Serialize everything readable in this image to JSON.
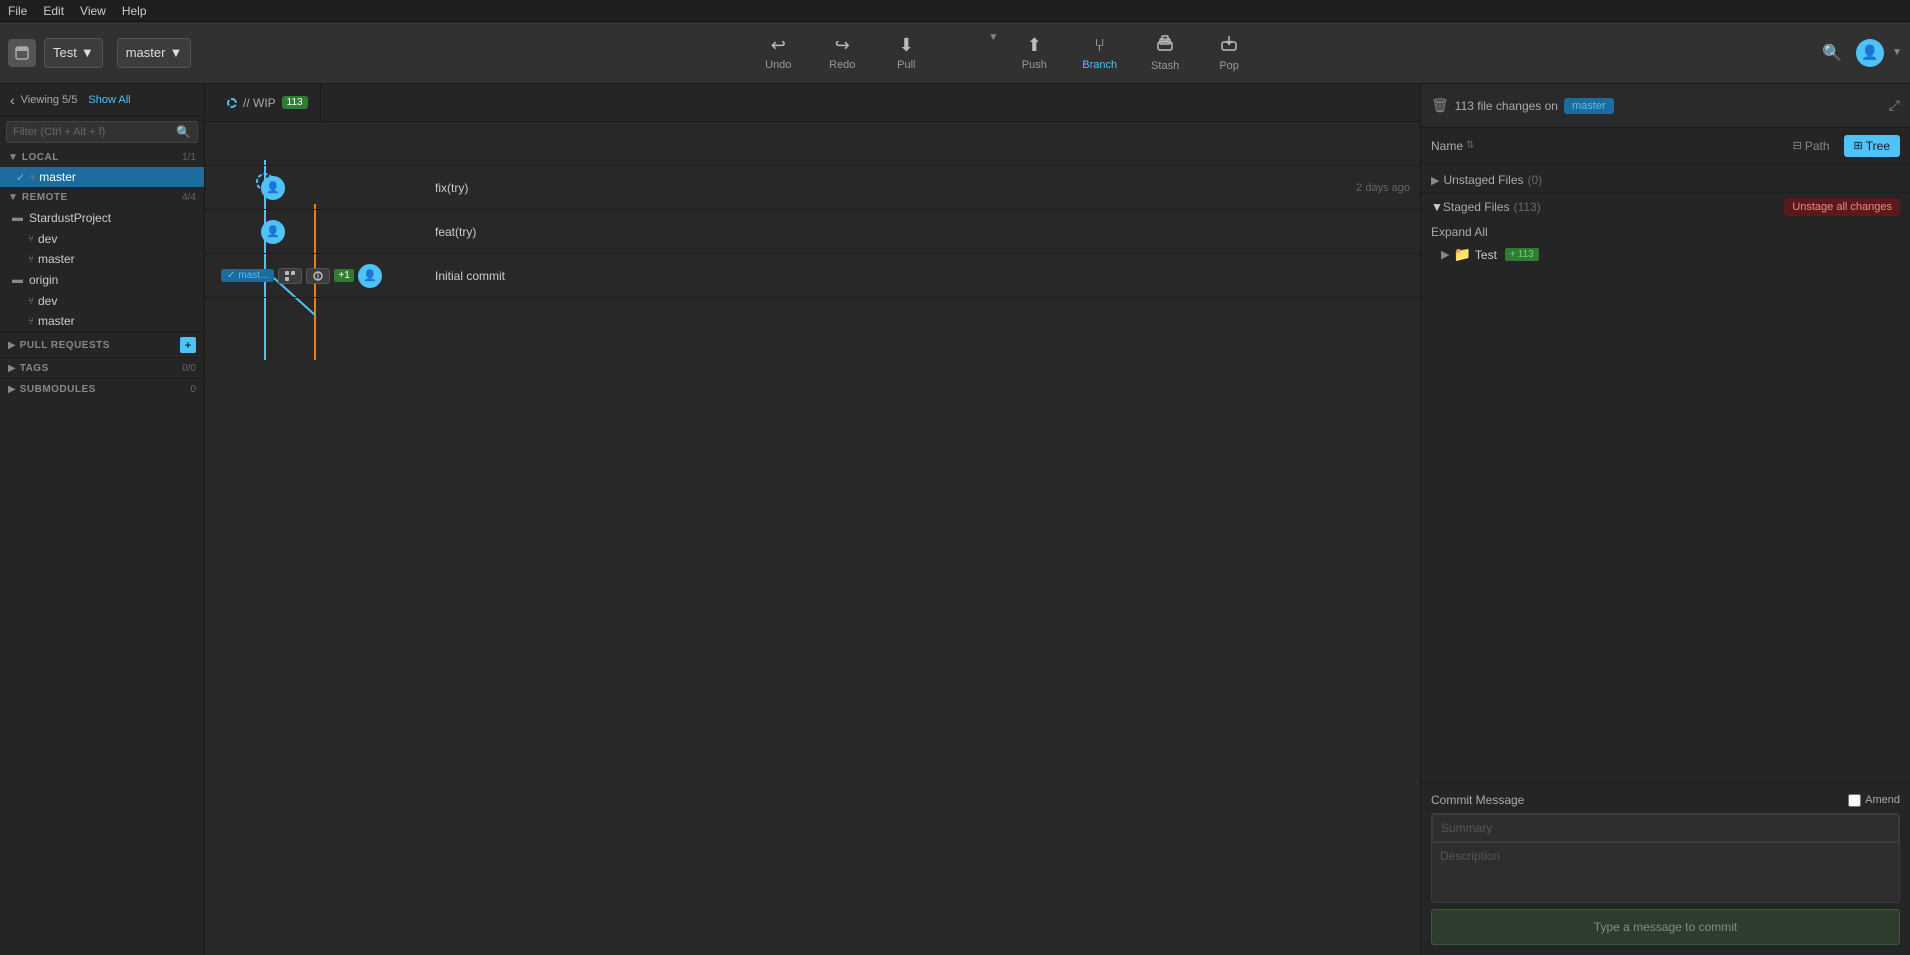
{
  "menubar": {
    "items": [
      "File",
      "Edit",
      "View",
      "Help"
    ]
  },
  "toolbar": {
    "repo_label": "Test",
    "branch_label": "master",
    "buttons": [
      {
        "id": "undo",
        "label": "Undo",
        "icon": "↩"
      },
      {
        "id": "redo",
        "label": "Redo",
        "icon": "↪"
      },
      {
        "id": "pull",
        "label": "Pull",
        "icon": "⬇"
      },
      {
        "id": "push",
        "label": "Push",
        "icon": "⬆"
      },
      {
        "id": "branch",
        "label": "Branch",
        "icon": "⑂"
      },
      {
        "id": "stash",
        "label": "Stash",
        "icon": "📦"
      },
      {
        "id": "pop",
        "label": "Pop",
        "icon": "📤"
      }
    ]
  },
  "sidebar": {
    "viewing_text": "Viewing 5/5",
    "show_all": "Show All",
    "filter_placeholder": "Filter (Ctrl + Alt + f)",
    "sections": {
      "local": {
        "title": "LOCAL",
        "count": "1/1",
        "branches": [
          "master"
        ]
      },
      "remote": {
        "title": "REMOTE",
        "count": "4/4",
        "remotes": [
          {
            "name": "StardustProject",
            "branches": [
              "dev",
              "master"
            ]
          },
          {
            "name": "origin",
            "branches": [
              "dev",
              "master"
            ]
          }
        ]
      },
      "pull_requests": {
        "title": "PULL REQUESTS"
      },
      "tags": {
        "title": "TAGS",
        "count": "0/0"
      },
      "submodules": {
        "title": "SUBMODULES",
        "count": "0"
      }
    }
  },
  "graph": {
    "wip_label": "// WIP",
    "staged_count": "113",
    "commits": [
      {
        "id": "wip",
        "branch_tags": [],
        "message": "",
        "time": "",
        "author": ""
      },
      {
        "id": "c1",
        "branch_tags": [],
        "message": "fix(try)",
        "time": "2 days ago",
        "author": "avatar"
      },
      {
        "id": "c2",
        "branch_tags": [],
        "message": "feat(try)",
        "time": "",
        "author": "avatar"
      },
      {
        "id": "c3",
        "branch_tags": [
          "mast...",
          "+1"
        ],
        "message": "Initial commit",
        "time": "",
        "author": "avatar"
      }
    ]
  },
  "right_panel": {
    "file_changes_text": "113 file changes on",
    "master_badge": "master",
    "view_tabs": {
      "name_label": "Name",
      "path_label": "Path",
      "tree_label": "Tree"
    },
    "unstaged_section": {
      "title": "Unstaged Files",
      "count": "(0)"
    },
    "staged_section": {
      "title": "Staged Files",
      "count": "(113)",
      "unstage_btn": "Unstage all changes",
      "expand_all": "Expand All",
      "folders": [
        {
          "name": "Test",
          "count": "113"
        }
      ]
    },
    "commit_message": {
      "title": "Commit Message",
      "amend_label": "Amend",
      "summary_placeholder": "Summary",
      "description_placeholder": "Description",
      "submit_placeholder": "Type a message to commit"
    }
  }
}
